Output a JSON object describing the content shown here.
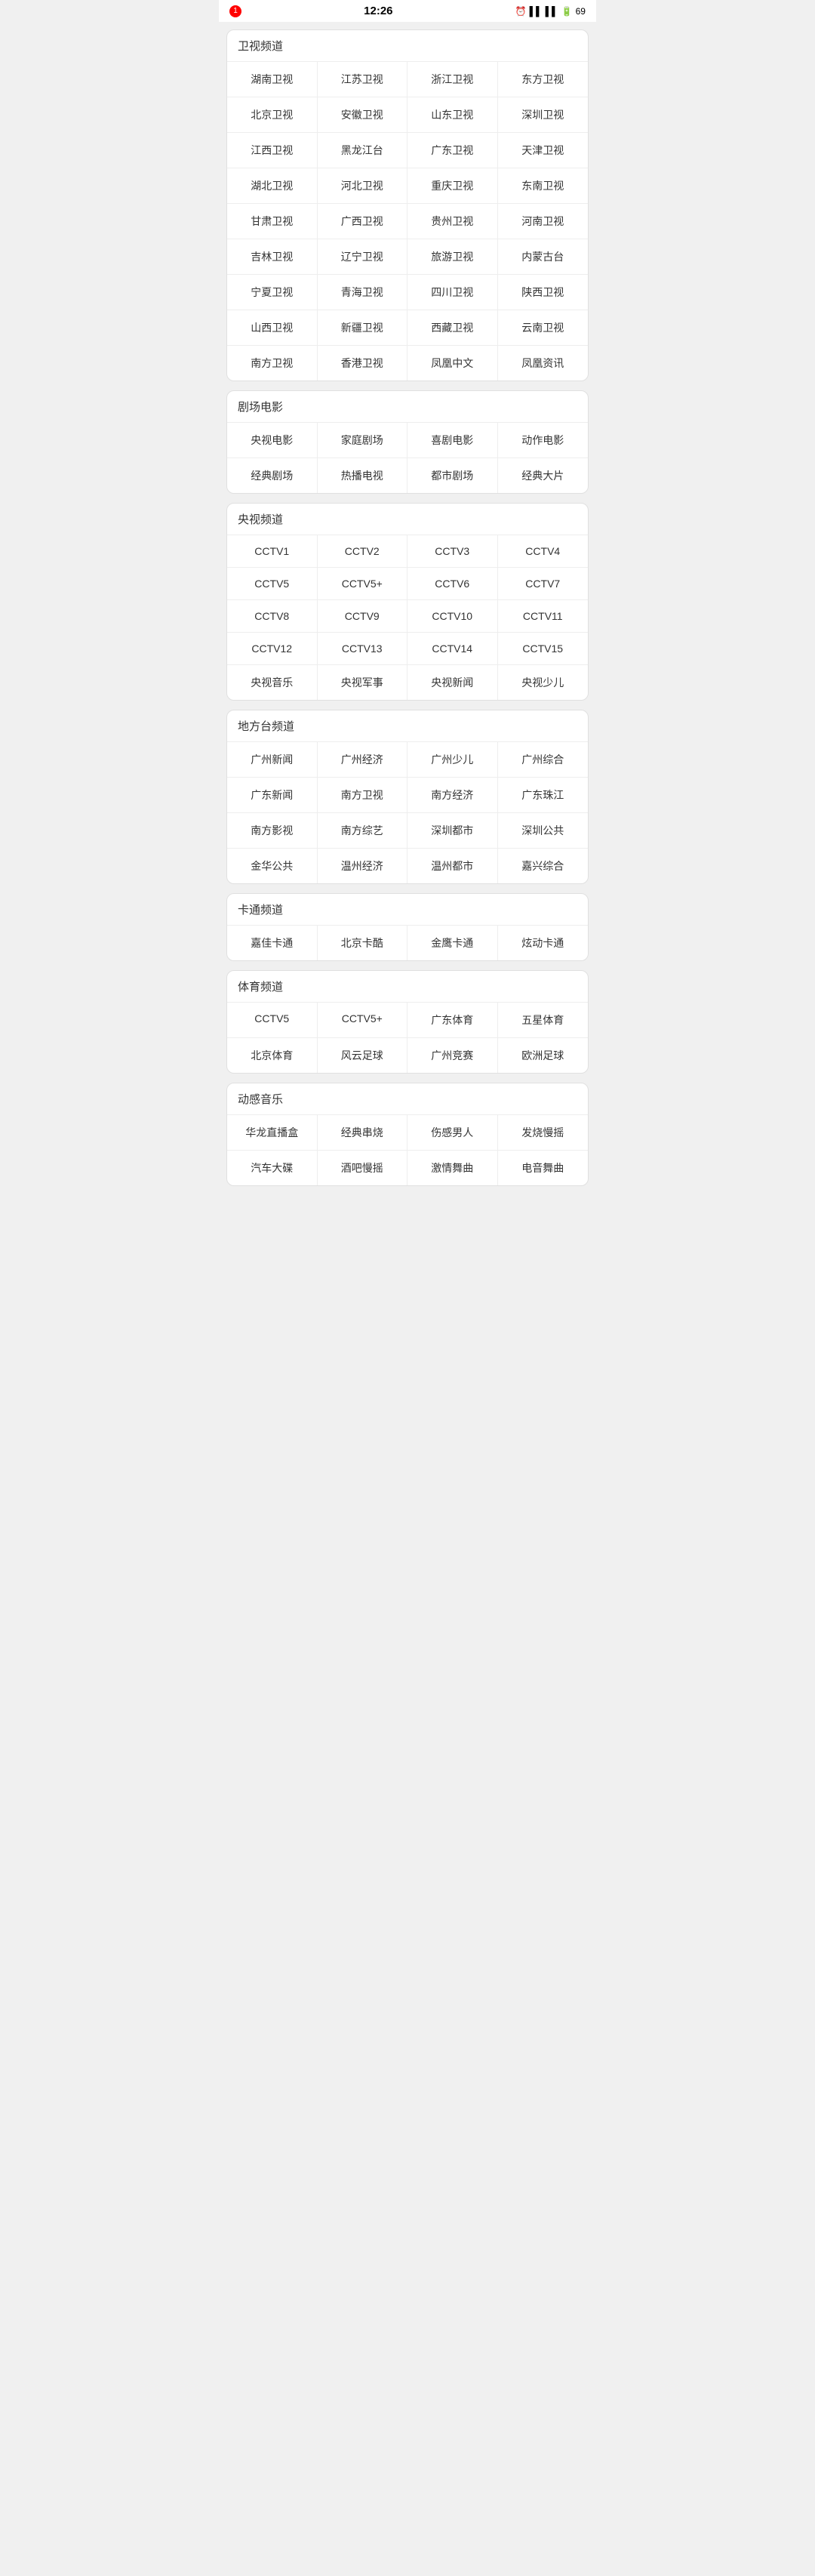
{
  "statusBar": {
    "time": "12:26",
    "notification": "1",
    "batteryLevel": "69"
  },
  "sections": [
    {
      "id": "satellite",
      "title": "卫视频道",
      "rows": [
        [
          "湖南卫视",
          "江苏卫视",
          "浙江卫视",
          "东方卫视"
        ],
        [
          "北京卫视",
          "安徽卫视",
          "山东卫视",
          "深圳卫视"
        ],
        [
          "江西卫视",
          "黑龙江台",
          "广东卫视",
          "天津卫视"
        ],
        [
          "湖北卫视",
          "河北卫视",
          "重庆卫视",
          "东南卫视"
        ],
        [
          "甘肃卫视",
          "广西卫视",
          "贵州卫视",
          "河南卫视"
        ],
        [
          "吉林卫视",
          "辽宁卫视",
          "旅游卫视",
          "内蒙古台"
        ],
        [
          "宁夏卫视",
          "青海卫视",
          "四川卫视",
          "陕西卫视"
        ],
        [
          "山西卫视",
          "新疆卫视",
          "西藏卫视",
          "云南卫视"
        ],
        [
          "南方卫视",
          "香港卫视",
          "凤凰中文",
          "凤凰资讯"
        ]
      ]
    },
    {
      "id": "theater",
      "title": "剧场电影",
      "rows": [
        [
          "央视电影",
          "家庭剧场",
          "喜剧电影",
          "动作电影"
        ],
        [
          "经典剧场",
          "热播电视",
          "都市剧场",
          "经典大片"
        ]
      ]
    },
    {
      "id": "cctv",
      "title": "央视频道",
      "rows": [
        [
          "CCTV1",
          "CCTV2",
          "CCTV3",
          "CCTV4"
        ],
        [
          "CCTV5",
          "CCTV5+",
          "CCTV6",
          "CCTV7"
        ],
        [
          "CCTV8",
          "CCTV9",
          "CCTV10",
          "CCTV11"
        ],
        [
          "CCTV12",
          "CCTV13",
          "CCTV14",
          "CCTV15"
        ],
        [
          "央视音乐",
          "央视军事",
          "央视新闻",
          "央视少儿"
        ]
      ]
    },
    {
      "id": "local",
      "title": "地方台频道",
      "rows": [
        [
          "广州新闻",
          "广州经济",
          "广州少儿",
          "广州综合"
        ],
        [
          "广东新闻",
          "南方卫视",
          "南方经济",
          "广东珠江"
        ],
        [
          "南方影视",
          "南方综艺",
          "深圳都市",
          "深圳公共"
        ],
        [
          "金华公共",
          "温州经济",
          "温州都市",
          "嘉兴综合"
        ]
      ]
    },
    {
      "id": "cartoon",
      "title": "卡通频道",
      "rows": [
        [
          "嘉佳卡通",
          "北京卡酷",
          "金鹰卡通",
          "炫动卡通"
        ]
      ]
    },
    {
      "id": "sports",
      "title": "体育频道",
      "rows": [
        [
          "CCTV5",
          "CCTV5+",
          "广东体育",
          "五星体育"
        ],
        [
          "北京体育",
          "风云足球",
          "广州竞赛",
          "欧洲足球"
        ]
      ]
    },
    {
      "id": "music",
      "title": "动感音乐",
      "rows": [
        [
          "华龙直播盒",
          "经典串烧",
          "伤感男人",
          "发烧慢摇"
        ],
        [
          "汽车大碟",
          "酒吧慢摇",
          "激情舞曲",
          "电音舞曲"
        ]
      ]
    }
  ]
}
